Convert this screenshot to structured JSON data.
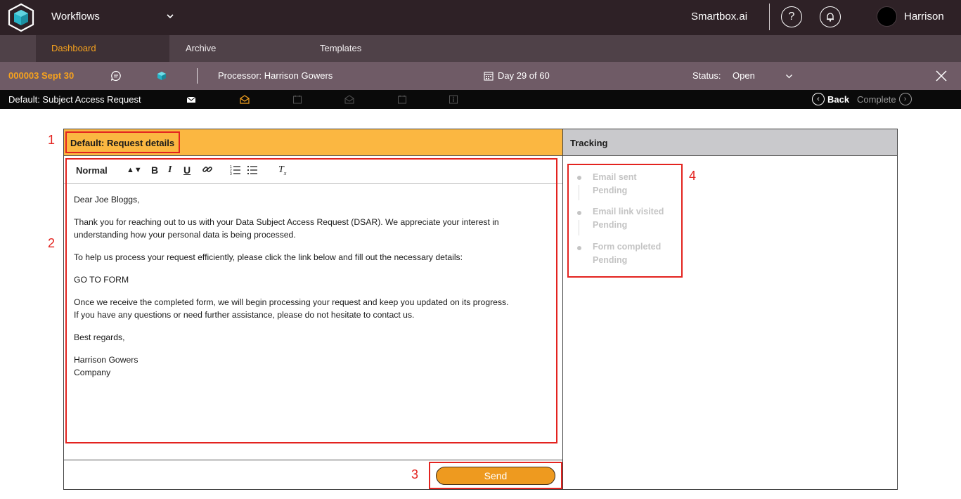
{
  "topbar": {
    "app_title": "Workflows",
    "brand": "Smartbox.ai",
    "help_glyph": "?",
    "user_name": "Harrison",
    "icons": [
      "cube-logo-icon",
      "chevron-down-icon",
      "help-icon",
      "bell-icon",
      "avatar"
    ]
  },
  "nav": {
    "tabs": [
      {
        "label": "Dashboard",
        "active": true
      },
      {
        "label": "Archive",
        "active": false
      },
      {
        "label": "Templates",
        "active": false
      }
    ]
  },
  "case": {
    "id": "000003 Sept 30",
    "processor": "Processor: Harrison Gowers",
    "day": "Day 29 of 60",
    "status_label": "Status:",
    "status_value": "Open"
  },
  "step": {
    "title": "Default: Subject Access Request",
    "icons": [
      "envelope-filled-icon",
      "envelope-open-icon",
      "calendar-icon",
      "envelope-open-icon",
      "calendar-icon",
      "info-icon"
    ],
    "back_label": "Back",
    "complete_label": "Complete"
  },
  "request": {
    "title": "Default: Request details",
    "toolbar": {
      "format": "Normal",
      "bold": "B",
      "italic": "I",
      "underline": "U",
      "clear": "T"
    },
    "body": {
      "greeting": "Dear Joe Bloggs,",
      "p1": "Thank you for reaching out to us with your Data Subject Access Request (DSAR). We appreciate your interest in understanding how your personal data is being processed.",
      "p2": "To help us process your request efficiently, please click the link below and fill out the necessary details:",
      "link": "GO TO FORM",
      "p3a": "Once we receive the completed form, we will begin processing your request and keep you updated on its progress.",
      "p3b": "If you have any questions or need further assistance, please do not hesitate to contact us.",
      "closing": "Best regards,",
      "sig_name": "Harrison Gowers",
      "sig_company": "Company"
    },
    "send_label": "Send"
  },
  "tracking": {
    "title": "Tracking",
    "items": [
      {
        "label": "Email sent",
        "status": "Pending"
      },
      {
        "label": "Email link visited",
        "status": "Pending"
      },
      {
        "label": "Form completed",
        "status": "Pending"
      }
    ]
  },
  "annotations": {
    "colors": {
      "accent": "#f6a21e",
      "annotation": "#e3231f",
      "header_orange": "#fbb741"
    },
    "numbers": [
      "1",
      "2",
      "3",
      "4"
    ]
  }
}
